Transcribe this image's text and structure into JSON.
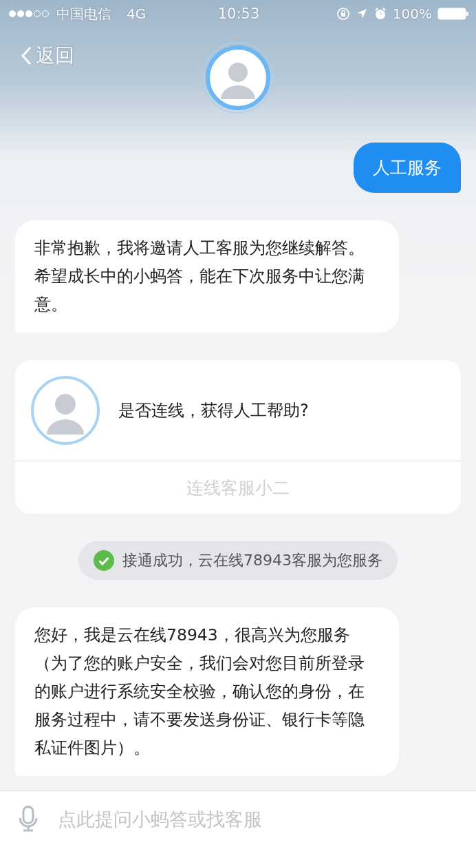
{
  "status_bar": {
    "carrier": "中国电信",
    "network": "4G",
    "time": "10:53",
    "battery": "100%"
  },
  "nav": {
    "back": "返回"
  },
  "messages": [
    {
      "kind": "user",
      "text": "人工服务"
    },
    {
      "kind": "bot",
      "text": "非常抱歉，我将邀请人工客服为您继续解答。希望成长中的小蚂答，能在下次服务中让您满意。"
    },
    {
      "kind": "card",
      "text": "是否连线，获得人工帮助?",
      "action": "连线客服小二",
      "disabled": true
    },
    {
      "kind": "notice",
      "text": "接通成功，云在线78943客服为您服务"
    },
    {
      "kind": "bot",
      "text": "您好，我是云在线78943，很高兴为您服务（为了您的账户安全，我们会对您目前所登录的账户进行系统安全校验，确认您的身份，在服务过程中，请不要发送身份证、银行卡等隐私证件图片）。"
    }
  ],
  "input": {
    "placeholder": "点此提问小蚂答或找客服"
  }
}
